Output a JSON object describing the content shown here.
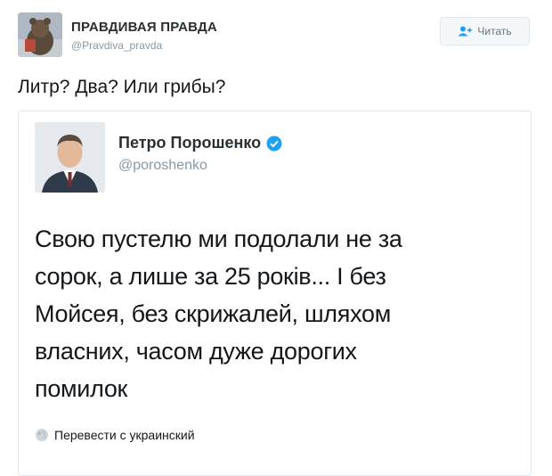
{
  "author": {
    "display_name": "ПРАВДИВАЯ ПРАВДА",
    "handle": "@Pravdiva_pravda",
    "avatar_icon": "bear-avatar"
  },
  "follow_button": {
    "label": "Читать",
    "icon": "add-user-icon"
  },
  "tweet": {
    "text": "Литр? Два? Или грибы?"
  },
  "quoted_tweet": {
    "display_name": "Петро Порошенко",
    "verified_icon": "verified-badge-icon",
    "handle": "@poroshenko",
    "lines": [
      "Свою пустелю ми подолали не за",
      "сорок, а лише за 25 років... І без",
      "Мойсея, без скрижалей, шляхом",
      "власних, часом дуже дорогих",
      "помилок"
    ],
    "translate_label": "Перевести с украинский",
    "translate_icon": "globe-icon"
  },
  "colors": {
    "verified": "#1da1f2",
    "secondary_text": "#8899a6",
    "border": "#e1e8ed"
  }
}
